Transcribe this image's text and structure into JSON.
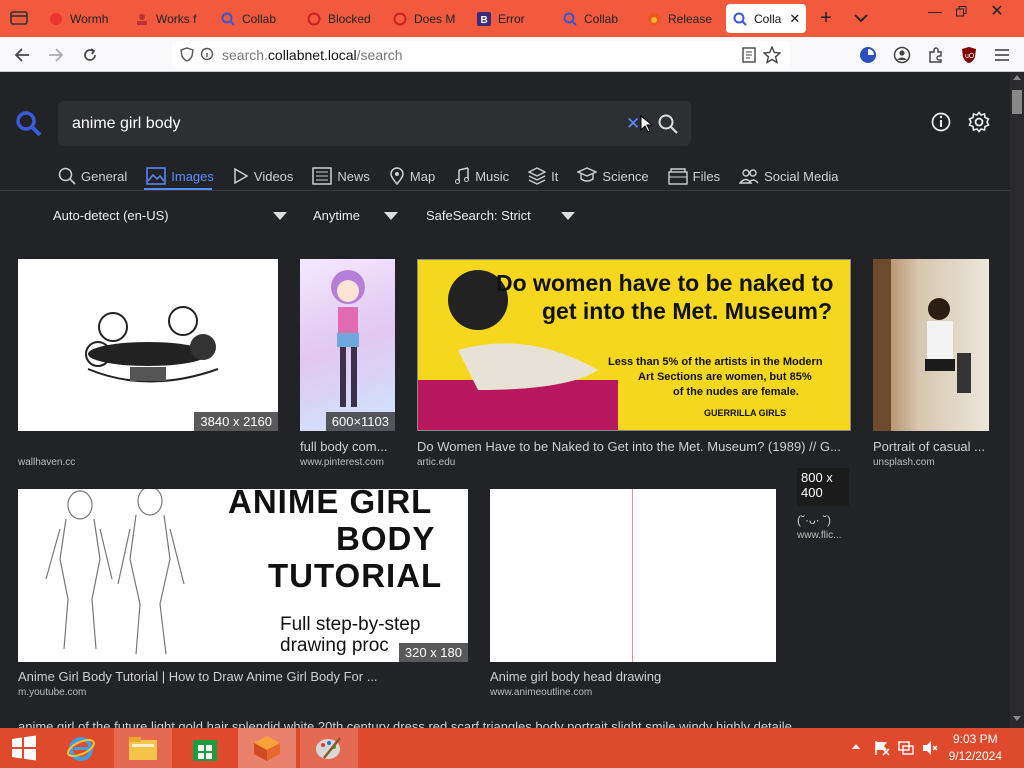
{
  "browser": {
    "tabs": [
      {
        "label": "Wormh",
        "icon": "worm-icon"
      },
      {
        "label": "Works f",
        "icon": "people-icon"
      },
      {
        "label": "Collab",
        "icon": "search-icon"
      },
      {
        "label": "Blocked",
        "icon": "blocked-icon"
      },
      {
        "label": "Does M",
        "icon": "blocked-icon"
      },
      {
        "label": "Error",
        "icon": "b-icon"
      },
      {
        "label": "Collab",
        "icon": "search-icon"
      },
      {
        "label": "Release",
        "icon": "fox-icon"
      },
      {
        "label": "Colla",
        "icon": "search-icon",
        "active": true
      }
    ],
    "url_prefix": "search.",
    "url_domain": "collabnet.local",
    "url_path": "/search"
  },
  "search": {
    "query": "anime girl body",
    "categories": [
      {
        "label": "General",
        "icon": "search-icon"
      },
      {
        "label": "Images",
        "icon": "image-icon",
        "active": true
      },
      {
        "label": "Videos",
        "icon": "play-icon"
      },
      {
        "label": "News",
        "icon": "news-icon"
      },
      {
        "label": "Map",
        "icon": "map-pin-icon"
      },
      {
        "label": "Music",
        "icon": "music-icon"
      },
      {
        "label": "It",
        "icon": "layers-icon"
      },
      {
        "label": "Science",
        "icon": "science-icon"
      },
      {
        "label": "Files",
        "icon": "files-icon"
      },
      {
        "label": "Social Media",
        "icon": "people-icon"
      }
    ],
    "filters": {
      "language": "Auto-detect (en-US)",
      "time": "Anytime",
      "safesearch": "SafeSearch: Strict"
    }
  },
  "results": [
    {
      "title": "",
      "source": "wallhaven.cc",
      "dims": "3840 x 2160"
    },
    {
      "title": "full body com...",
      "source": "www.pinterest.com",
      "dims": "600×1103"
    },
    {
      "title": "Do Women Have to be Naked to Get into the Met. Museum? (1989) // G...",
      "source": "artic.edu",
      "dims": "",
      "poster_l1": "Do women have to be naked to",
      "poster_l2": "get into the Met. Museum?",
      "poster_sub1": "Less than 5% of the artists in the Modern",
      "poster_sub2": "Art Sections are women, but 85%",
      "poster_sub3": "of the nudes are female.",
      "poster_brand": "GUERRILLA GIRLS"
    },
    {
      "title": "Portrait of casual ...",
      "source": "unsplash.com",
      "dims": ""
    },
    {
      "title": "(˘·ᴗ· ˘)",
      "source": "www.flic...",
      "dims": "800 x\n400"
    },
    {
      "title": "Anime Girl Body Tutorial | How to Draw Anime Girl Body For ...",
      "source": "m.youtube.com",
      "dims": "320 x 180",
      "poster_l1": "ANIME GIRL",
      "poster_l2": "BODY",
      "poster_l3": "TUTORIAL",
      "poster_sub1": "Full step-by-step",
      "poster_sub2": "drawing proc"
    },
    {
      "title": "Anime girl body head drawing",
      "source": "www.animeoutline.com",
      "dims": ""
    }
  ],
  "bottom_text": "anime girl of the future light gold hair splendid white 20th century dress red scarf triangles body portrait slight smile windy highly detaile",
  "taskbar": {
    "time": "9:03 PM",
    "date": "9/12/2024"
  }
}
